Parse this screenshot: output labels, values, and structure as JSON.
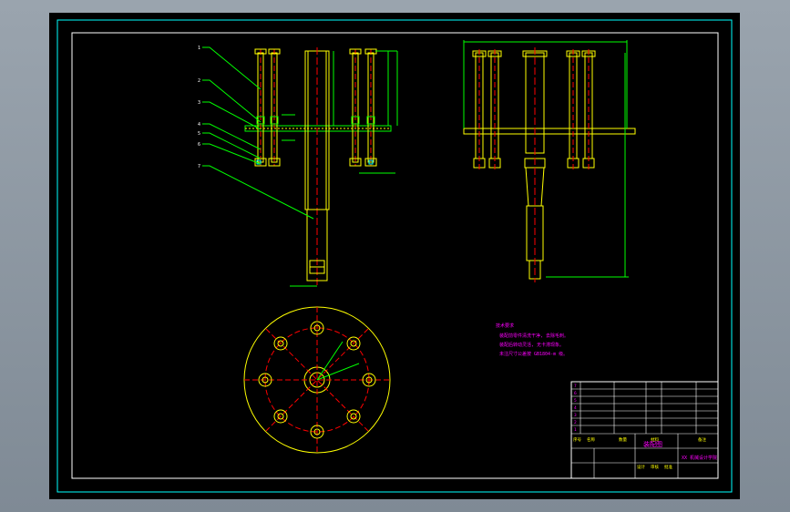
{
  "colors": {
    "background": "#000000",
    "frame": "#ffffff",
    "outer_frame": "#00ffff",
    "yellow": "#ffff00",
    "green": "#00ff00",
    "red": "#ff0000",
    "magenta": "#ff00ff",
    "white": "#ffffff",
    "cyan": "#00ffff"
  },
  "notes": {
    "heading": "技术要求",
    "lines": [
      "装配前零件清洗干净, 去除毛刺。",
      "装配后转动灵活, 无卡滞现象。",
      "未注尺寸公差按 GB1804-m 级。"
    ]
  },
  "title_block": {
    "drawing_name": "装配图",
    "school": "XX 机械设计学院",
    "rows": [
      "7",
      "6",
      "5",
      "4",
      "3",
      "2",
      "1"
    ],
    "header_labels": [
      "序号",
      "名称",
      "数量",
      "材料",
      "备注"
    ],
    "sign_labels": [
      "设计",
      "审核",
      "批准"
    ]
  },
  "balloons": [
    "1",
    "2",
    "3",
    "4",
    "5",
    "6",
    "7"
  ]
}
